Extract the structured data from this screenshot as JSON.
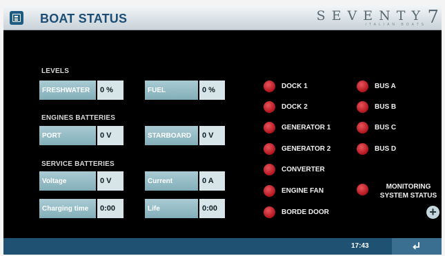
{
  "header": {
    "title": "BOAT STATUS",
    "brand": "SEVENTY",
    "brand_number": "7",
    "brand_sub": "ITALIAN BOATS"
  },
  "levels": {
    "section_label": "LEVELS",
    "freshwater": {
      "label": "FRESHWATER",
      "value": "0 %"
    },
    "fuel": {
      "label": "FUEL",
      "value": "0 %"
    }
  },
  "engines_batteries": {
    "section_label": "ENGINES BATTERIES",
    "port": {
      "label": "PORT",
      "value": "0 V"
    },
    "starboard": {
      "label": "STARBOARD",
      "value": "0 V"
    }
  },
  "service_batteries": {
    "section_label": "SERVICE BATTERIES",
    "voltage": {
      "label": "Voltage",
      "value": "0 V"
    },
    "current": {
      "label": "Current",
      "value": "0 A"
    },
    "charging_time": {
      "label": "Charging time",
      "value": "0:00"
    },
    "life": {
      "label": "Life",
      "value": "0:00"
    }
  },
  "status_left": [
    "DOCK 1",
    "DOCK 2",
    "GENERATOR 1",
    "GENERATOR 2",
    "CONVERTER",
    "ENGINE FAN",
    "BORDE DOOR"
  ],
  "status_right": [
    "BUS A",
    "BUS B",
    "BUS C",
    "BUS D"
  ],
  "monitoring": {
    "line1": "MONITORING",
    "line2": "SYSTEM STATUS"
  },
  "footer": {
    "time": "17:43"
  },
  "colors": {
    "indicator": "#d4232b",
    "header_blue": "#1c4e75",
    "footer": "#1f5173"
  }
}
